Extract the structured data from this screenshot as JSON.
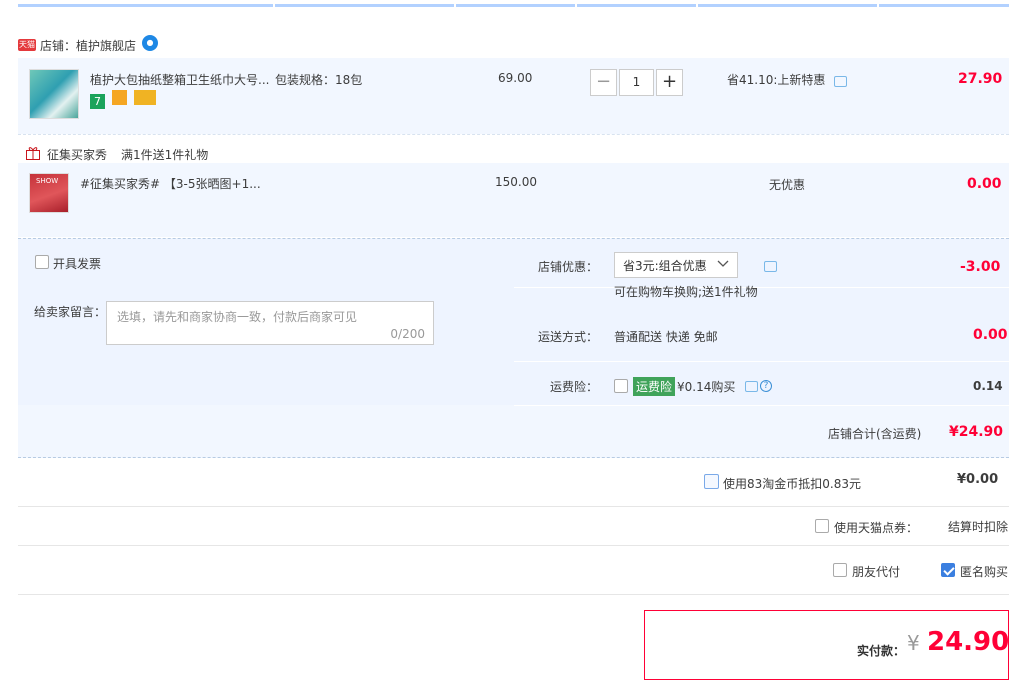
{
  "shop": {
    "badge": "天猫",
    "label": "店铺：植护旗舰店"
  },
  "items": [
    {
      "title": "植护大包抽纸整箱卫生纸巾大号...",
      "spec": "包装规格：18包",
      "unit_price": "69.00",
      "quantity": "1",
      "promotion": "省41.10:上新特惠",
      "subtotal": "27.90"
    },
    {
      "title": "#征集买家秀# 【3-5张晒图+1...",
      "unit_price": "150.00",
      "promotion": "无优惠",
      "subtotal": "0.00",
      "thumb_text": "SHOW"
    }
  ],
  "gift_bar": {
    "title": "征集买家秀",
    "desc": "满1件送1件礼物"
  },
  "invoice": {
    "label": "开具发票"
  },
  "message": {
    "label": "给卖家留言：",
    "placeholder": "选填，请先和商家协商一致，付款后商家可见",
    "counter": "0/200"
  },
  "shop_discount": {
    "label": "店铺优惠：",
    "selected": "省3元:组合优惠",
    "note": "可在购物车换购;送1件礼物",
    "amount": "-3.00"
  },
  "shipping": {
    "label": "运送方式：",
    "method": "普通配送 快递 免邮",
    "amount": "0.00"
  },
  "freight_insurance": {
    "label": "运费险：",
    "tag": "运费险",
    "desc": "¥0.14购买",
    "amount": "0.14"
  },
  "shop_total": {
    "label": "店铺合计(含运费)",
    "amount": "¥24.90"
  },
  "coins": {
    "label": "使用83淘金币抵扣0.83元",
    "amount": "¥0.00"
  },
  "points": {
    "label": "使用天猫点券：",
    "value": "结算时扣除"
  },
  "options": {
    "friend_pay": "朋友代付",
    "anonymous": "匿名购买",
    "anonymous_checked": true
  },
  "pay": {
    "label": "实付款：",
    "currency": "¥",
    "amount": "24.90"
  },
  "colors": {
    "accent": "#ff0036",
    "panel_bg": "#f2f7ff",
    "checkbox_on": "#3b7fe0"
  }
}
